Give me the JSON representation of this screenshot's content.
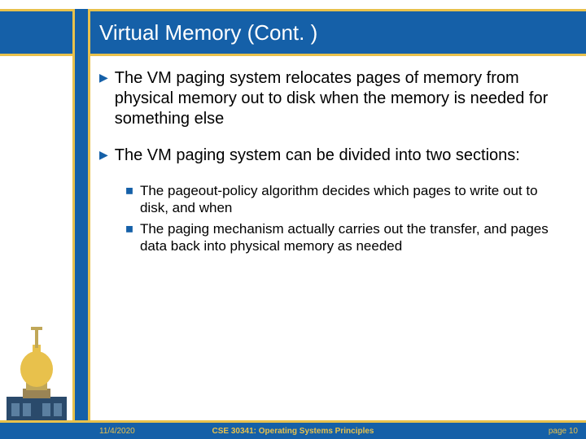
{
  "header": {
    "title": "Virtual Memory (Cont. )"
  },
  "content": {
    "bullets": [
      {
        "text": "The VM paging system relocates pages of memory from physical memory out to disk when the memory is needed for something else"
      },
      {
        "text": "The VM paging system can be divided into two sections:",
        "sub": [
          "The pageout-policy algorithm decides which pages to write out to disk, and when",
          "The paging mechanism actually carries out the transfer, and pages data back into physical memory as needed"
        ]
      }
    ]
  },
  "footer": {
    "date": "11/4/2020",
    "center": "CSE 30341: Operating Systems Principles",
    "page": "page 10"
  }
}
